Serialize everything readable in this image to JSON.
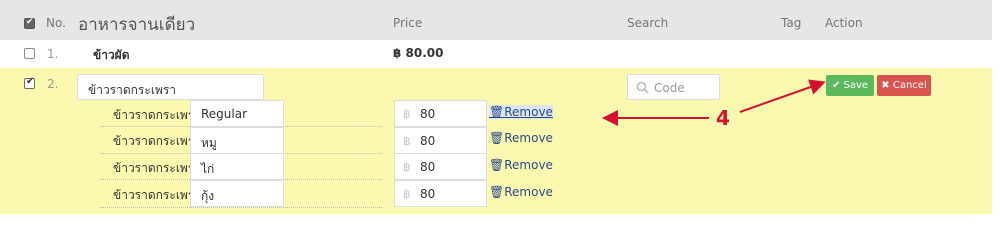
{
  "header": {
    "col_no": "No.",
    "title": "อาหารจานเดียว",
    "col_price": "Price",
    "col_search": "Search",
    "col_tag": "Tag",
    "col_action": "Action"
  },
  "rows": [
    {
      "no": "1.",
      "name": "ข้าวผัด",
      "price": "฿ 80.00"
    }
  ],
  "edit_row": {
    "no": "2.",
    "name_value": "ข้าวราดกระเพรา",
    "search_placeholder": "Code",
    "save_label": "Save",
    "cancel_label": "Cancel",
    "options": [
      {
        "label": "ข้าวราดกระเพรา",
        "variant": "Regular",
        "currency": "฿",
        "price": "80",
        "remove": "Remove"
      },
      {
        "label": "ข้าวราดกระเพรา",
        "variant": "หมู",
        "currency": "฿",
        "price": "80",
        "remove": "Remove"
      },
      {
        "label": "ข้าวราดกระเพรา",
        "variant": "ไก่",
        "currency": "฿",
        "price": "80",
        "remove": "Remove"
      },
      {
        "label": "ข้าวราดกระเพรา",
        "variant": "กุ้ง",
        "currency": "฿",
        "price": "80",
        "remove": "Remove"
      }
    ]
  },
  "annotation": {
    "label": "4",
    "color": "#d6102e"
  },
  "colors": {
    "save": "#5cb85c",
    "cancel": "#d9534f",
    "edit_row_bg": "#fbf9b0"
  }
}
